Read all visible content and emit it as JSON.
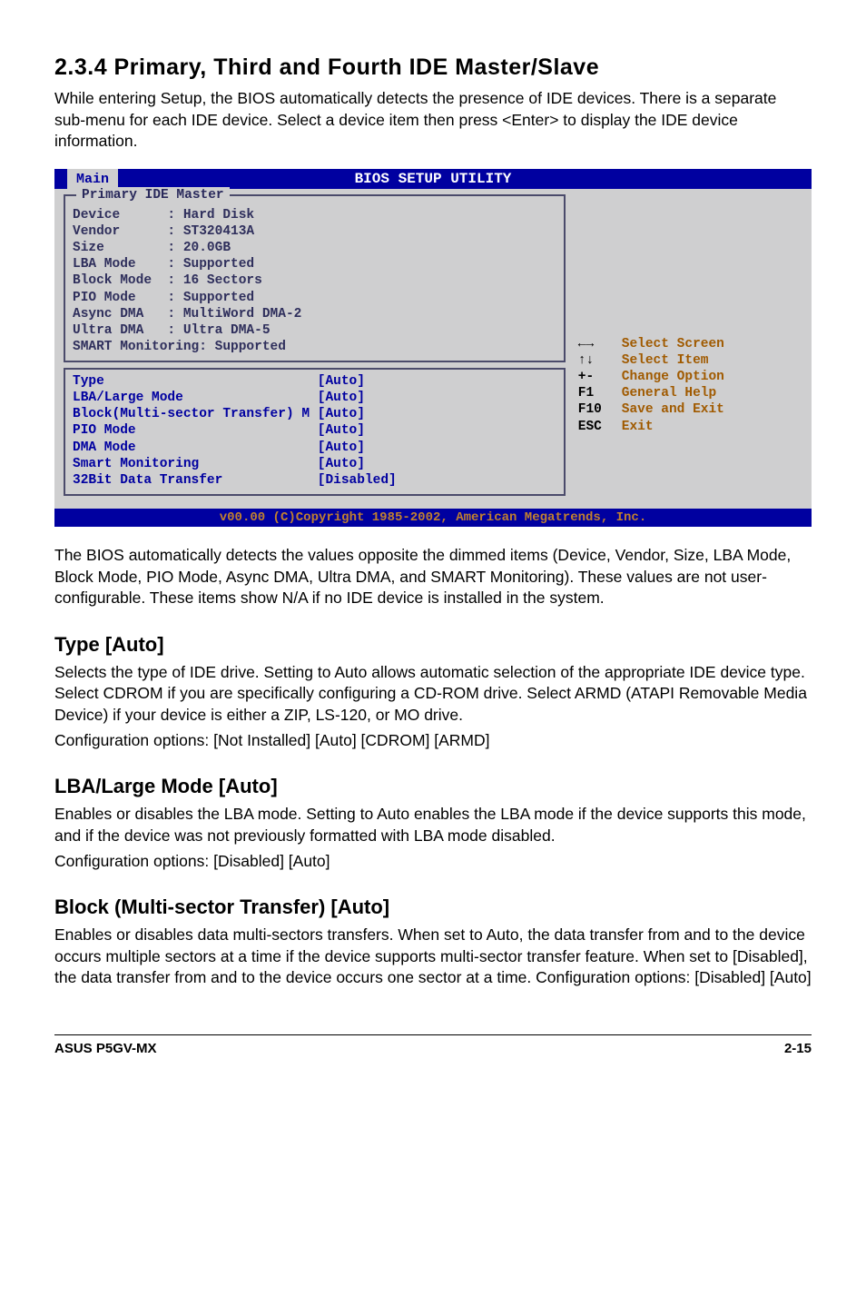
{
  "heading": "2.3.4   Primary, Third and Fourth IDE Master/Slave",
  "intro": "While entering Setup, the BIOS automatically detects the presence of IDE devices. There is a separate sub-menu for each IDE device. Select a device item then press <Enter> to display the IDE device information.",
  "bios": {
    "title": "BIOS SETUP UTILITY",
    "tab": "Main",
    "panel1_title": "Primary IDE Master",
    "detected": [
      {
        "label": "Device",
        "value": "Hard Disk"
      },
      {
        "label": "Vendor",
        "value": "ST320413A"
      },
      {
        "label": "Size",
        "value": "20.0GB"
      },
      {
        "label": "LBA Mode",
        "value": "Supported"
      },
      {
        "label": "Block Mode",
        "value": "16 Sectors"
      },
      {
        "label": "PIO Mode",
        "value": "Supported"
      },
      {
        "label": "Async DMA",
        "value": "MultiWord DMA-2"
      },
      {
        "label": "Ultra DMA",
        "value": "Ultra DMA-5"
      },
      {
        "label": "SMART Monitoring",
        "value": "Supported",
        "nocolon": true
      }
    ],
    "options": [
      {
        "label": "Type",
        "value": "[Auto]"
      },
      {
        "label": "LBA/Large Mode",
        "value": "[Auto]"
      },
      {
        "label": "Block(Multi-sector Transfer) M",
        "value": "[Auto]"
      },
      {
        "label": "PIO Mode",
        "value": "[Auto]"
      },
      {
        "label": "DMA Mode",
        "value": "[Auto]"
      },
      {
        "label": "Smart Monitoring",
        "value": "[Auto]"
      },
      {
        "label": "32Bit Data Transfer",
        "value": "[Disabled]"
      }
    ],
    "legend": [
      {
        "key": "←→",
        "desc": "Select Screen"
      },
      {
        "key": "↑↓",
        "desc": "Select Item"
      },
      {
        "key": "+-",
        "desc": "Change Option"
      },
      {
        "key": "F1",
        "desc": "General Help"
      },
      {
        "key": "F10",
        "desc": "Save and Exit"
      },
      {
        "key": "ESC",
        "desc": "Exit"
      }
    ],
    "footer": "v00.00 (C)Copyright 1985-2002, American Megatrends, Inc."
  },
  "after_bios": "The BIOS automatically detects the values opposite the dimmed items (Device, Vendor, Size, LBA Mode, Block Mode, PIO Mode, Async DMA, Ultra DMA, and SMART Monitoring). These values are not user-configurable. These items show N/A if no IDE device is installed in the system.",
  "sections": [
    {
      "title": "Type [Auto]",
      "paras": [
        "Selects the type of IDE drive. Setting to Auto allows automatic selection of the appropriate IDE device type. Select CDROM if you are specifically configuring a CD-ROM drive. Select ARMD (ATAPI Removable Media Device) if your device is either a ZIP, LS-120, or MO drive.",
        "Configuration options: [Not Installed] [Auto] [CDROM] [ARMD]"
      ]
    },
    {
      "title": "LBA/Large Mode [Auto]",
      "paras": [
        "Enables or disables the LBA mode. Setting to Auto enables the LBA mode if the device supports this mode, and if the device was not previously formatted with LBA mode disabled.",
        "Configuration options: [Disabled] [Auto]"
      ]
    },
    {
      "title": "Block (Multi-sector Transfer) [Auto]",
      "paras": [
        "Enables or disables data multi-sectors transfers. When set to Auto, the data transfer from and to the device occurs multiple sectors at a time if the device supports multi-sector transfer feature. When set to [Disabled], the data transfer from and to the device occurs one sector at a time. Configuration options: [Disabled] [Auto]"
      ]
    }
  ],
  "footer_left": "ASUS P5GV-MX",
  "footer_right": "2-15"
}
